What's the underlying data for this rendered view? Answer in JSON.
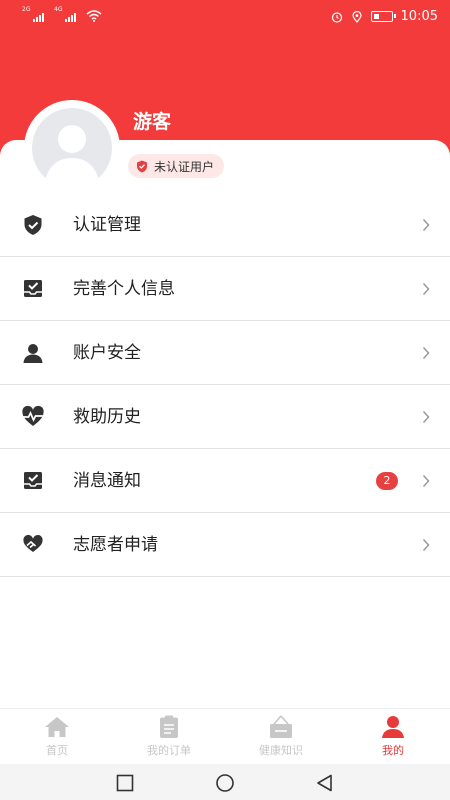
{
  "status_bar": {
    "sim1_tag": "2G",
    "sim2_tag": "4G",
    "time": "10:05",
    "battery_level": 0.35
  },
  "profile": {
    "username": "游客",
    "verify_status": "未认证用户"
  },
  "menu": [
    {
      "label": "认证管理",
      "icon": "shield-check-icon"
    },
    {
      "label": "完善个人信息",
      "icon": "inbox-check-icon"
    },
    {
      "label": "账户安全",
      "icon": "user-icon"
    },
    {
      "label": "救助历史",
      "icon": "heart-pulse-icon"
    },
    {
      "label": "消息通知",
      "icon": "inbox-check-icon",
      "badge": "2"
    },
    {
      "label": "志愿者申请",
      "icon": "helping-hands-icon"
    }
  ],
  "tabs": [
    {
      "label": "首页",
      "icon": "home-icon",
      "active": false
    },
    {
      "label": "我的订单",
      "icon": "clipboard-icon",
      "active": false
    },
    {
      "label": "健康知识",
      "icon": "signboard-icon",
      "active": false
    },
    {
      "label": "我的",
      "icon": "person-icon",
      "active": true
    }
  ],
  "colors": {
    "brand_red": "#f33b3b",
    "badge_red": "#e64040",
    "tab_active": "#e73a3a",
    "tab_inactive": "#c7c7c7"
  }
}
